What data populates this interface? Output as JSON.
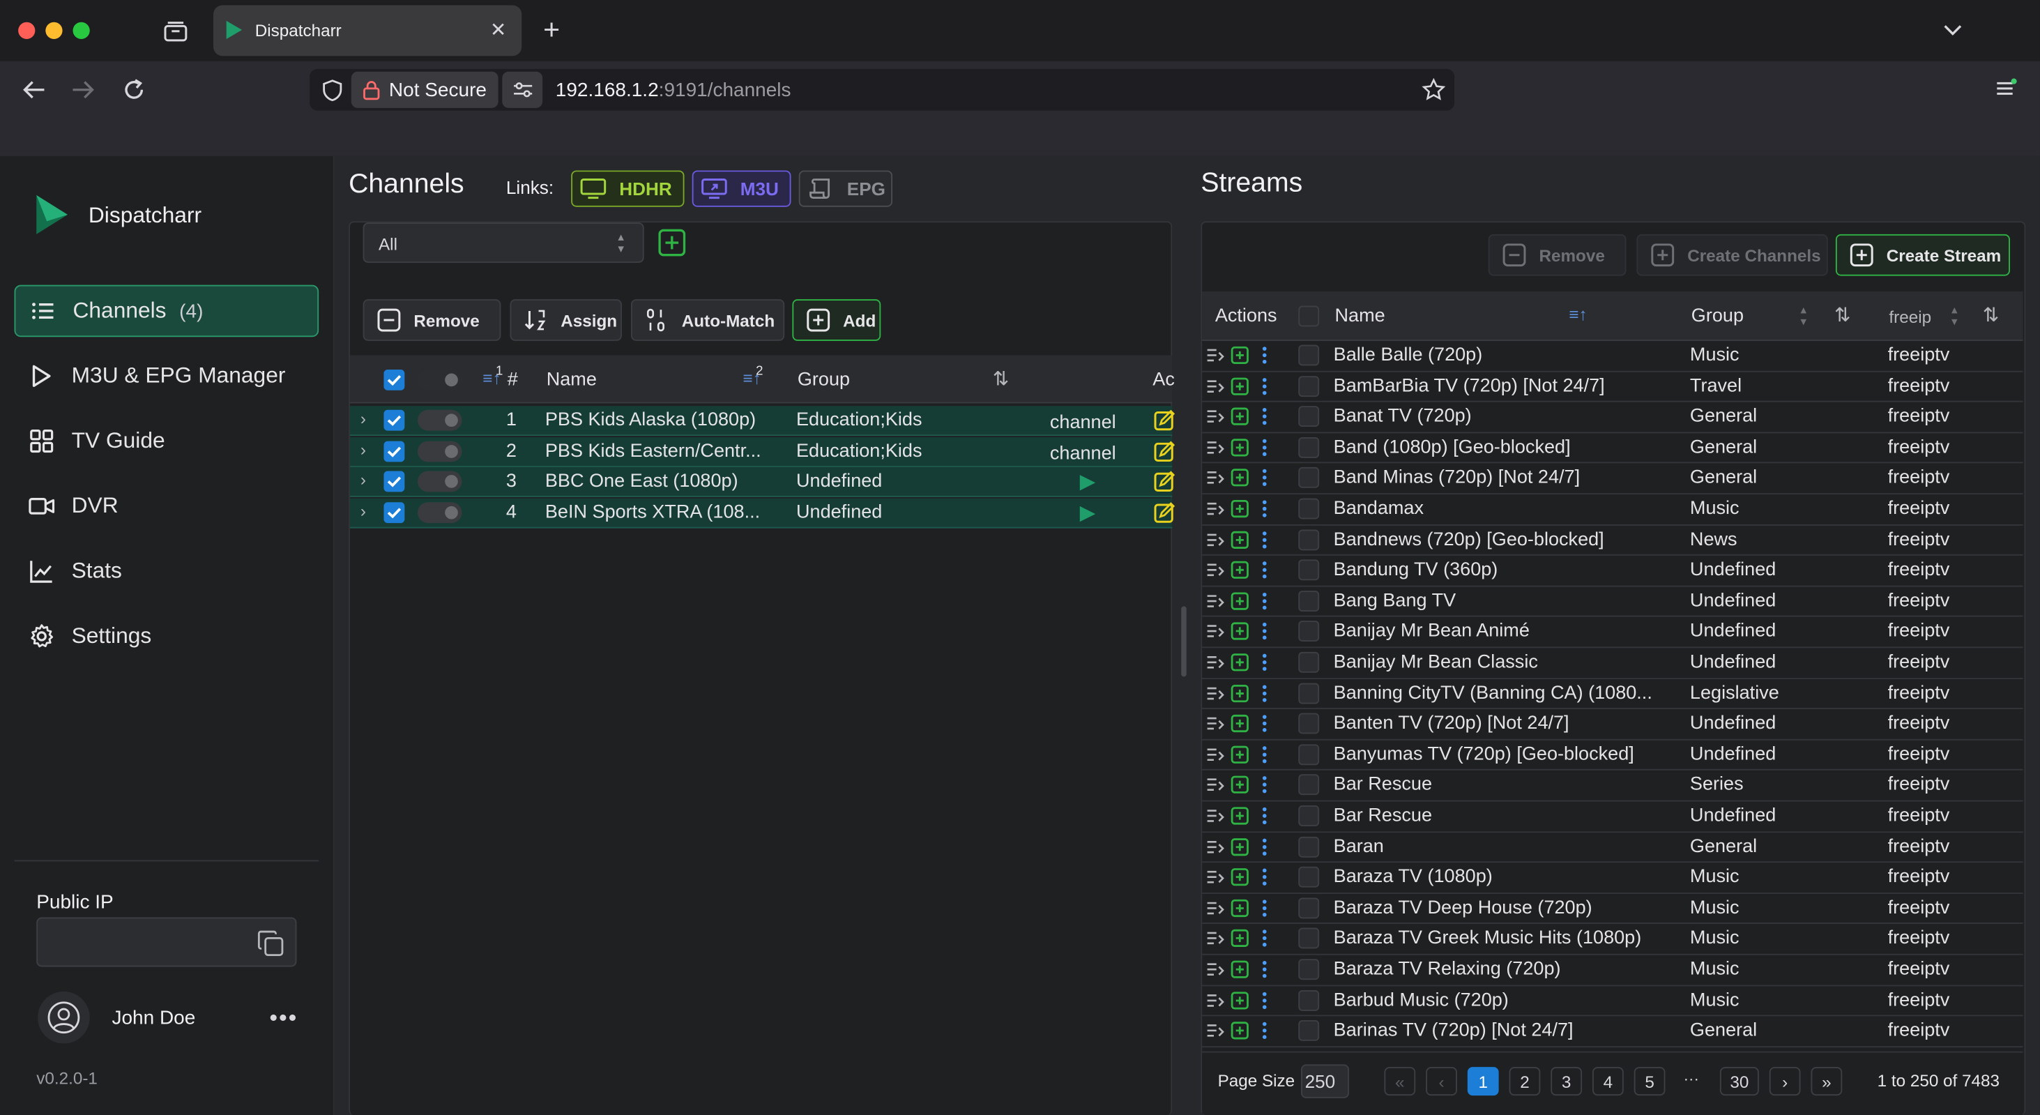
{
  "browser": {
    "tab_title": "Dispatcharr",
    "security_label": "Not Secure",
    "url_host": "192.168.1.2",
    "url_rest": ":9191/channels"
  },
  "sidebar": {
    "app_name": "Dispatcharr",
    "items": [
      {
        "label": "Channels",
        "count": "(4)",
        "icon": "list-icon",
        "active": true
      },
      {
        "label": "M3U & EPG Manager",
        "icon": "play-icon"
      },
      {
        "label": "TV Guide",
        "icon": "grid-icon"
      },
      {
        "label": "DVR",
        "icon": "video-icon"
      },
      {
        "label": "Stats",
        "icon": "chart-icon"
      },
      {
        "label": "Settings",
        "icon": "gear-icon"
      }
    ],
    "public_ip_label": "Public IP",
    "public_ip_value": "",
    "user_name": "John Doe",
    "version": "v0.2.0-1"
  },
  "channels": {
    "title": "Channels",
    "links_label": "Links:",
    "link_hdhr": "HDHR",
    "link_m3u": "M3U",
    "link_epg": "EPG",
    "filter_value": "All",
    "buttons": {
      "remove": "Remove",
      "assign": "Assign",
      "auto_match": "Auto-Match",
      "add": "Add"
    },
    "columns": {
      "number": "#",
      "name": "Name",
      "group": "Group",
      "actions": "Ac"
    },
    "sort_badges": {
      "number": "1",
      "name": "2"
    },
    "rows": [
      {
        "number": "1",
        "name": "PBS Kids Alaska (1080p)",
        "group": "Education;Kids",
        "logo": "channel"
      },
      {
        "number": "2",
        "name": "PBS Kids Eastern/Centr...",
        "group": "Education;Kids",
        "logo": "channel"
      },
      {
        "number": "3",
        "name": "BBC One East (1080p)",
        "group": "Undefined",
        "logo": ""
      },
      {
        "number": "4",
        "name": "BeIN Sports XTRA (108...",
        "group": "Undefined",
        "logo": ""
      }
    ]
  },
  "streams": {
    "title": "Streams",
    "buttons": {
      "remove": "Remove",
      "create_channels": "Create Channels",
      "create_stream": "Create Stream"
    },
    "columns": {
      "actions": "Actions",
      "name": "Name",
      "group": "Group",
      "m3u": "freeip"
    },
    "rows": [
      {
        "name": "Balle Balle (720p)",
        "group": "Music",
        "m3u": "freeiptv"
      },
      {
        "name": "BamBarBia TV (720p) [Not 24/7]",
        "group": "Travel",
        "m3u": "freeiptv"
      },
      {
        "name": "Banat TV (720p)",
        "group": "General",
        "m3u": "freeiptv"
      },
      {
        "name": "Band (1080p) [Geo-blocked]",
        "group": "General",
        "m3u": "freeiptv"
      },
      {
        "name": "Band Minas (720p) [Not 24/7]",
        "group": "General",
        "m3u": "freeiptv"
      },
      {
        "name": "Bandamax",
        "group": "Music",
        "m3u": "freeiptv"
      },
      {
        "name": "Bandnews (720p) [Geo-blocked]",
        "group": "News",
        "m3u": "freeiptv"
      },
      {
        "name": "Bandung TV (360p)",
        "group": "Undefined",
        "m3u": "freeiptv"
      },
      {
        "name": "Bang Bang TV",
        "group": "Undefined",
        "m3u": "freeiptv"
      },
      {
        "name": "Banijay Mr Bean Animé",
        "group": "Undefined",
        "m3u": "freeiptv"
      },
      {
        "name": "Banijay Mr Bean Classic",
        "group": "Undefined",
        "m3u": "freeiptv"
      },
      {
        "name": "Banning CityTV (Banning CA) (1080...",
        "group": "Legislative",
        "m3u": "freeiptv"
      },
      {
        "name": "Banten TV (720p) [Not 24/7]",
        "group": "Undefined",
        "m3u": "freeiptv"
      },
      {
        "name": "Banyumas TV (720p) [Geo-blocked]",
        "group": "Undefined",
        "m3u": "freeiptv"
      },
      {
        "name": "Bar Rescue",
        "group": "Series",
        "m3u": "freeiptv"
      },
      {
        "name": "Bar Rescue",
        "group": "Undefined",
        "m3u": "freeiptv"
      },
      {
        "name": "Baran",
        "group": "General",
        "m3u": "freeiptv"
      },
      {
        "name": "Baraza TV (1080p)",
        "group": "Music",
        "m3u": "freeiptv"
      },
      {
        "name": "Baraza TV Deep House (720p)",
        "group": "Music",
        "m3u": "freeiptv"
      },
      {
        "name": "Baraza TV Greek Music Hits (1080p)",
        "group": "Music",
        "m3u": "freeiptv"
      },
      {
        "name": "Baraza TV Relaxing (720p)",
        "group": "Music",
        "m3u": "freeiptv"
      },
      {
        "name": "Barbud Music (720p)",
        "group": "Music",
        "m3u": "freeiptv"
      },
      {
        "name": "Barinas TV (720p) [Not 24/7]",
        "group": "General",
        "m3u": "freeiptv"
      }
    ],
    "pagination": {
      "page_size_label": "Page Size",
      "page_size": "250",
      "pages": [
        "1",
        "2",
        "3",
        "4",
        "5"
      ],
      "ellipsis": "···",
      "last_page": "30",
      "current_page": "1",
      "summary": "1 to 250 of 7483"
    }
  },
  "colors": {
    "accent_green": "#2fb344",
    "hdhr": "#a3d63c",
    "m3u": "#7c6cf2",
    "selected_row": "#153d36",
    "checkbox_blue": "#1c7ed6",
    "page_active": "#1c7ed6"
  }
}
